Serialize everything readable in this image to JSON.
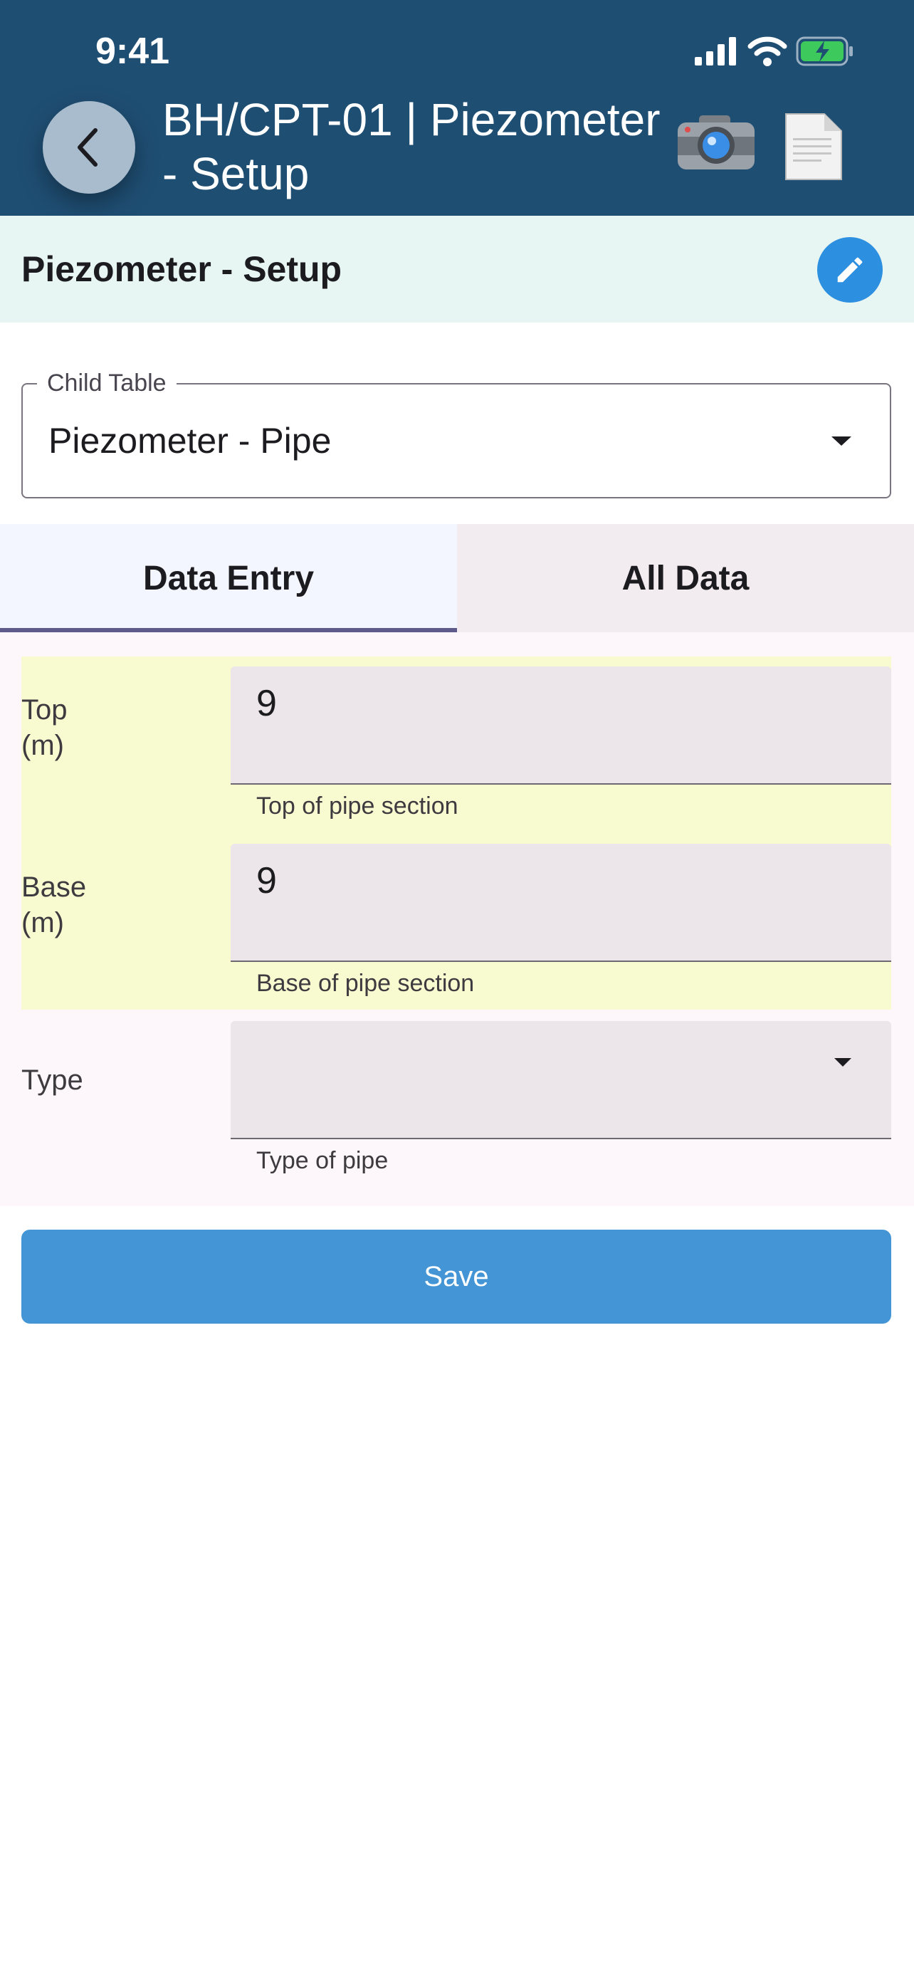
{
  "status_bar": {
    "time": "9:41"
  },
  "header": {
    "title": "BH/CPT-01 | Piezometer - Setup",
    "background_color": "#1f4e73",
    "icons": {
      "back": "chevron-left-icon",
      "camera": "camera-icon",
      "document": "document-icon"
    }
  },
  "section": {
    "title": "Piezometer - Setup",
    "edit_icon": "pencil-icon",
    "accent_color": "#2c8fe0"
  },
  "child_table": {
    "legend": "Child Table",
    "value": "Piezometer - Pipe"
  },
  "tabs": [
    {
      "label": "Data Entry",
      "active": true
    },
    {
      "label": "All Data",
      "active": false
    }
  ],
  "fields": {
    "top": {
      "label_line1": "Top",
      "label_line2": "(m)",
      "value": "9",
      "helper": "Top of pipe section"
    },
    "base": {
      "label_line1": "Base",
      "label_line2": "(m)",
      "value": "9",
      "helper": "Base of pipe section"
    },
    "type": {
      "label": "Type",
      "value": "",
      "helper": "Type of pipe"
    }
  },
  "save": {
    "label": "Save",
    "color": "#4495d6"
  }
}
